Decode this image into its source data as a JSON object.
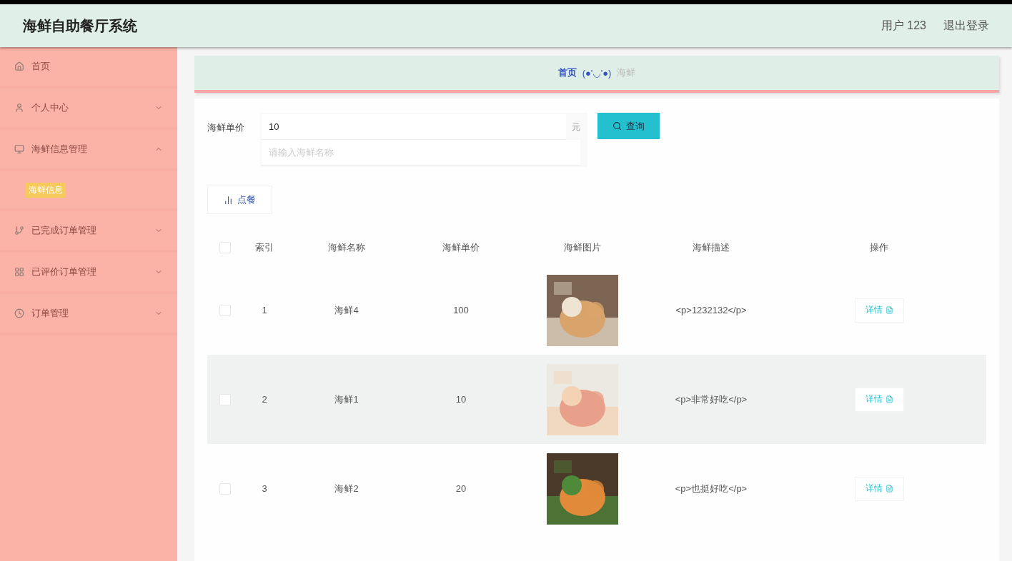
{
  "header": {
    "title": "海鲜自助餐厅系统",
    "user": "用户 123",
    "logout": "退出登录"
  },
  "sidebar": {
    "items": [
      {
        "label": "首页"
      },
      {
        "label": "个人中心",
        "expanded": false
      },
      {
        "label": "海鲜信息管理",
        "expanded": true,
        "children": [
          {
            "label": "海鲜信息",
            "selected": true
          }
        ]
      },
      {
        "label": "已完成订单管理",
        "expanded": false
      },
      {
        "label": "已评价订单管理",
        "expanded": false
      },
      {
        "label": "订单管理",
        "expanded": false
      }
    ]
  },
  "breadcrumb": {
    "home": "首页",
    "face": "(●'◡'●)",
    "current": "海鲜"
  },
  "search": {
    "label": "海鲜单价",
    "value": "10",
    "unit": "元",
    "placeholder": "请输入海鲜名称",
    "button": "查询"
  },
  "order_button": "点餐",
  "table": {
    "select_all": false,
    "columns": [
      "索引",
      "海鲜名称",
      "海鲜单价",
      "海鲜图片",
      "海鲜描述",
      "操作"
    ],
    "rows": [
      {
        "index": "1",
        "name": "海鲜4",
        "price": "100",
        "description": "<p>1232132</p>",
        "action": "详情",
        "checked": false
      },
      {
        "index": "2",
        "name": "海鲜1",
        "price": "10",
        "description": "<p>非常好吃</p>",
        "action": "详情",
        "checked": false
      },
      {
        "index": "3",
        "name": "海鲜2",
        "price": "20",
        "description": "<p>也挺好吃</p>",
        "action": "详情",
        "checked": false
      }
    ]
  }
}
